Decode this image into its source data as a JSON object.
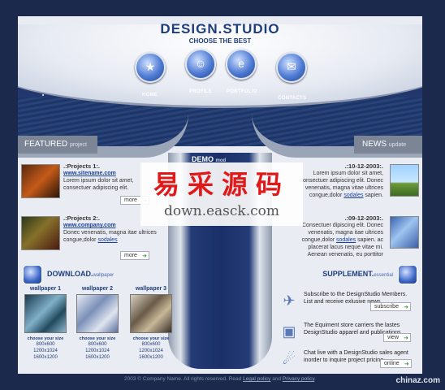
{
  "header": {
    "logo_main": "DESIGN",
    "logo_dot": ".",
    "logo_tail": "STUDIO",
    "tagline": "CHOOSE THE BEST"
  },
  "nav": {
    "items": [
      {
        "label": "HOME",
        "icon": "star-icon"
      },
      {
        "label": "PROFILE",
        "icon": "people-icon"
      },
      {
        "label": "PORTFOLIO",
        "icon": "ie-icon"
      },
      {
        "label": "CONTACTS",
        "icon": "envelope-icon"
      }
    ]
  },
  "featured": {
    "title": "FEATURED",
    "sub": "project"
  },
  "news_bar": {
    "title": "NEWS",
    "sub": "update"
  },
  "demo": {
    "title": "DEMO",
    "sub": "mod"
  },
  "projects": [
    {
      "title": ".:Projects 1:.",
      "link": "www.sitename.com",
      "text": "Lorem ipsum dolor sit amet, consectuer adipiscing elit.",
      "more": "more"
    },
    {
      "title": ".:Projects 2:.",
      "link": "www.company.com",
      "text": "Donec venenatis, magna itae ultrices congue,dolor",
      "link2": "sodales",
      "more": "more"
    }
  ],
  "news": [
    {
      "date": ".:10-12-2003:.",
      "text": "Lorem ipsum dolor sit amet, consectuer adipiscing elit. Donec venenatis, magna vitae ultrices congue,dolor",
      "link": "sodales",
      "tail": " sapien."
    },
    {
      "date": ".:09-12-2003:.",
      "text": "Consectuer dipiscing elit. Donec venenatis, magna itae ultrices congue,dolor",
      "link": "sodales",
      "tail": " sapien. ac placerat lacus neque vitae mi. Aenean venenatis, eu porttitor"
    }
  ],
  "download": {
    "title": "DOWNLOAD.",
    "sub": "wallpaper",
    "wallpapers": [
      {
        "title": "wallpaper 1",
        "choose": "choose your size",
        "sizes": [
          "800x600",
          "1200x1024",
          "1600x1200"
        ]
      },
      {
        "title": "wallpaper 2",
        "choose": "choose your size",
        "sizes": [
          "800x600",
          "1200x1024",
          "1600x1200"
        ]
      },
      {
        "title": "wallpaper 3",
        "choose": "choose your size",
        "sizes": [
          "800x600",
          "1200x1024",
          "1600x1200"
        ]
      }
    ]
  },
  "supplement": {
    "title": "SUPPLEMENT.",
    "sub": "essential",
    "items": [
      {
        "text": "Subscribe to the DesignStudio Members. List and receive exlusive news...",
        "button": "subscribe",
        "icon": "paper-plane-icon"
      },
      {
        "text": "The Equiment store carriers the lastes DesignStudio apparel and publications.",
        "button": "view",
        "icon": "box-icon"
      },
      {
        "text": "Chat live with a DesignStudio  sales agent inorder to inquire project pricing.",
        "button": "online",
        "icon": "satellite-icon"
      }
    ]
  },
  "footer": {
    "text": "2003 © Company Name. All rights reserved. Read ",
    "link1": "Legal policy",
    "and": " and ",
    "link2": "Privacy policy",
    "end": "."
  },
  "watermark": {
    "cn": "易采源码",
    "en": "down.easck.com"
  },
  "corner": "chinaz.com"
}
